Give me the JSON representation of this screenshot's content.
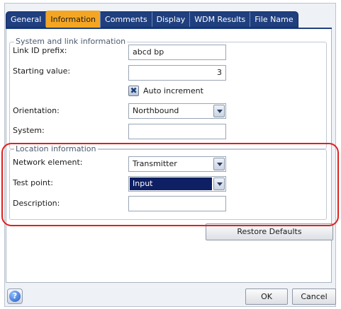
{
  "tabs": [
    {
      "label": "General",
      "active": false
    },
    {
      "label": "Information",
      "active": true
    },
    {
      "label": "Comments",
      "active": false
    },
    {
      "label": "Display",
      "active": false
    },
    {
      "label": "WDM Results",
      "active": false
    },
    {
      "label": "File Name",
      "active": false
    }
  ],
  "system_group": {
    "title": "System and link information",
    "link_id_prefix": {
      "label": "Link ID prefix:",
      "value": "abcd bp"
    },
    "starting_value": {
      "label": "Starting value:",
      "value": "3"
    },
    "auto_increment": {
      "label": "Auto increment",
      "checked": true,
      "mark": "✖"
    },
    "orientation": {
      "label": "Orientation:",
      "value": "Northbound"
    },
    "system": {
      "label": "System:",
      "value": ""
    }
  },
  "location_group": {
    "title": "Location information",
    "network_element": {
      "label": "Network element:",
      "value": "Transmitter"
    },
    "test_point": {
      "label": "Test point:",
      "value": "Input"
    },
    "description": {
      "label": "Description:",
      "value": ""
    }
  },
  "buttons": {
    "restore_defaults": "Restore Defaults",
    "ok": "OK",
    "cancel": "Cancel",
    "help": "?"
  },
  "colors": {
    "tab_bar": "#1f3f7f",
    "active_tab": "#f4a623",
    "selection": "#0f1f63",
    "highlight_ring": "#e02020"
  }
}
